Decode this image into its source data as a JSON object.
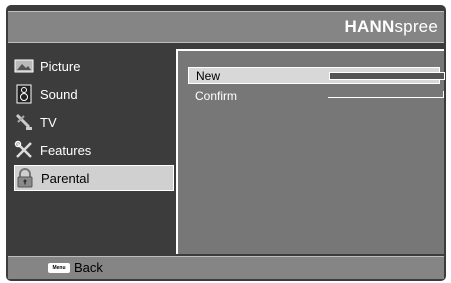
{
  "header": {
    "brand_bold": "HANN",
    "brand_light": "spree"
  },
  "sidebar": {
    "items": [
      {
        "label": "Picture",
        "icon": "picture-icon"
      },
      {
        "label": "Sound",
        "icon": "speaker-icon"
      },
      {
        "label": "TV",
        "icon": "antenna-icon"
      },
      {
        "label": "Features",
        "icon": "tools-icon"
      },
      {
        "label": "Parental",
        "icon": "lock-icon",
        "selected": true
      }
    ]
  },
  "panel": {
    "rows": [
      {
        "label": "New",
        "active": true
      },
      {
        "label": "Confirm",
        "active": false
      }
    ]
  },
  "footer": {
    "menu_key_label": "Menu",
    "back_label": "Back"
  }
}
